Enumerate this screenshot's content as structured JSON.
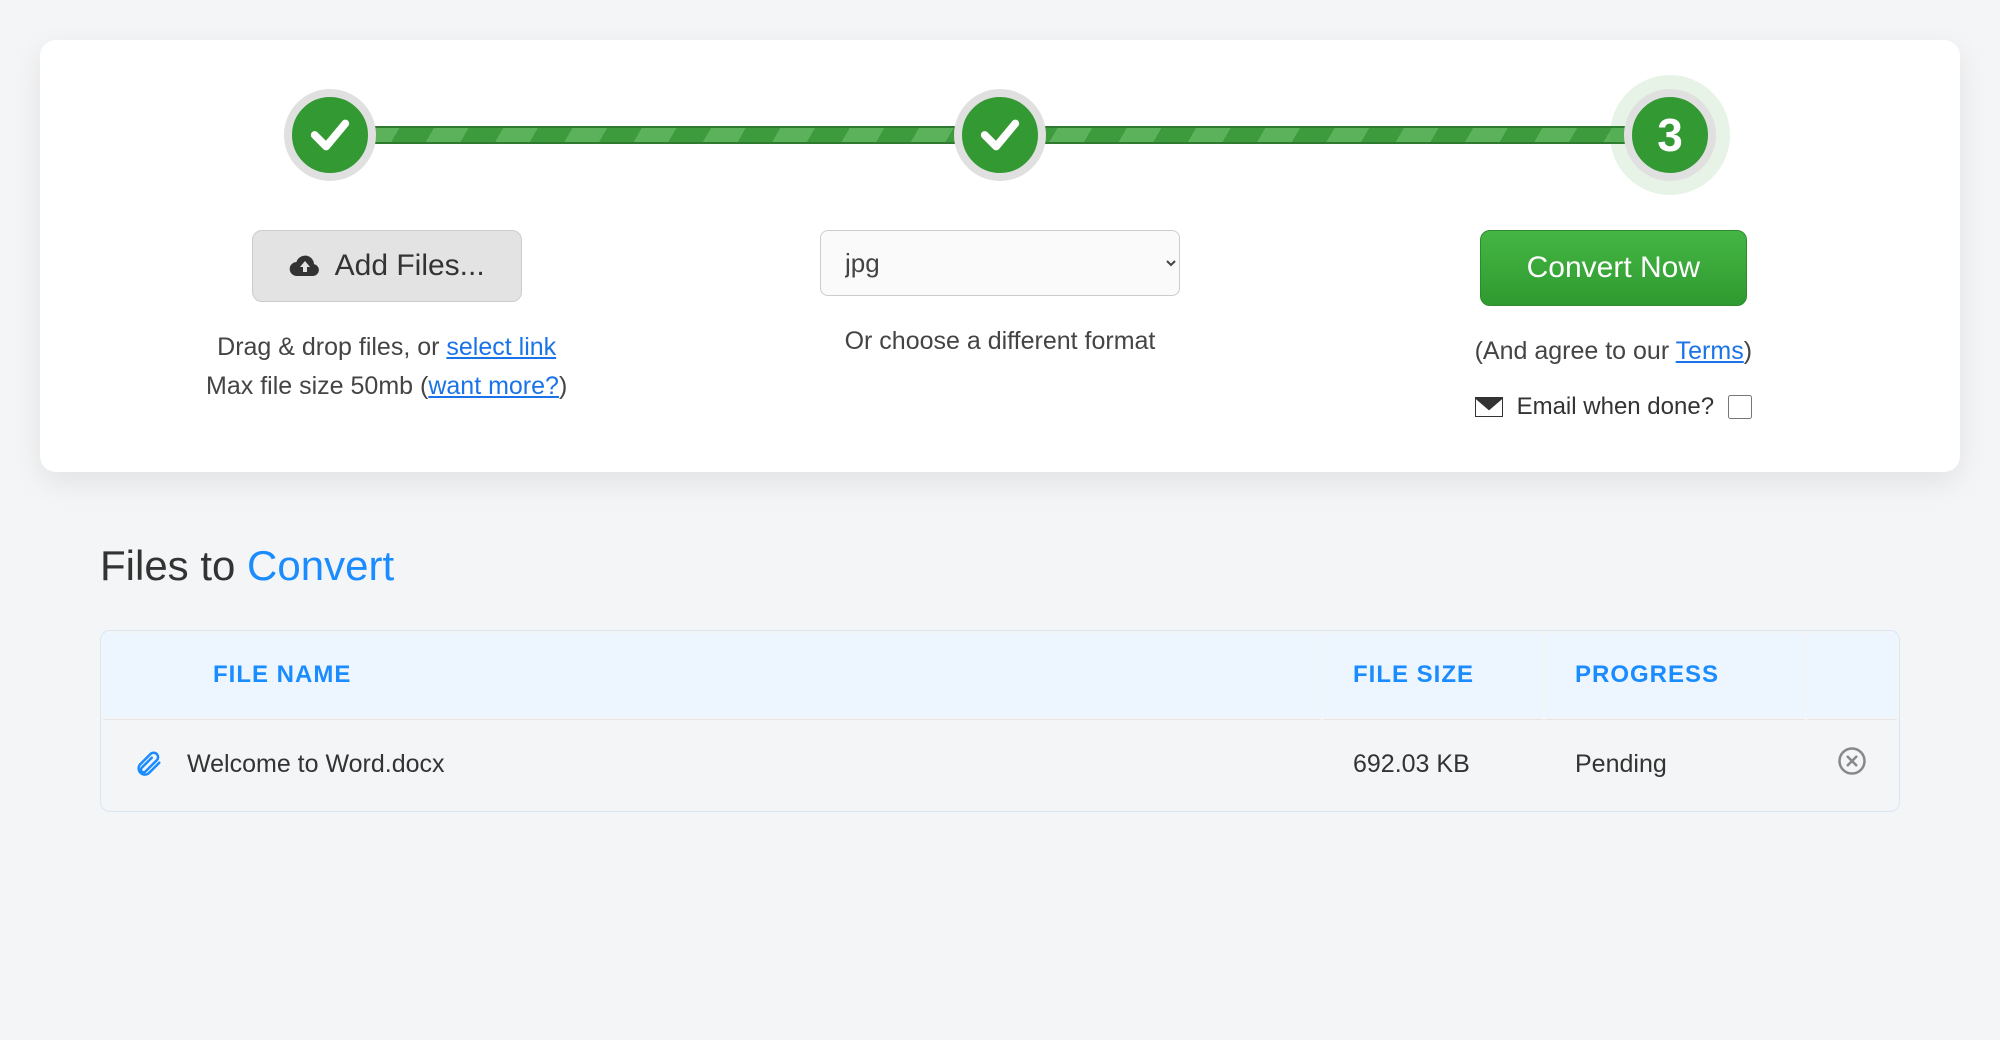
{
  "stepper": {
    "steps": [
      {
        "state": "done"
      },
      {
        "state": "done"
      },
      {
        "state": "current",
        "label": "3"
      }
    ]
  },
  "addFiles": {
    "buttonLabel": "Add Files...",
    "help1_pre": "Drag & drop files, or ",
    "help1_link": "select link",
    "help2_pre": "Max file size 50mb (",
    "help2_link": "want more?",
    "help2_post": ")"
  },
  "format": {
    "selected": "jpg",
    "help": "Or choose a different format"
  },
  "convert": {
    "buttonLabel": "Convert Now",
    "terms_pre": "(And agree to our ",
    "terms_link": "Terms",
    "terms_post": ")",
    "emailLabel": "Email when done?",
    "emailChecked": false
  },
  "filesSection": {
    "heading_pre": "Files to ",
    "heading_accent": "Convert",
    "columns": {
      "name": "FILE NAME",
      "size": "FILE SIZE",
      "progress": "PROGRESS"
    },
    "rows": [
      {
        "name": "Welcome to Word.docx",
        "size": "692.03 KB",
        "progress": "Pending"
      }
    ]
  }
}
